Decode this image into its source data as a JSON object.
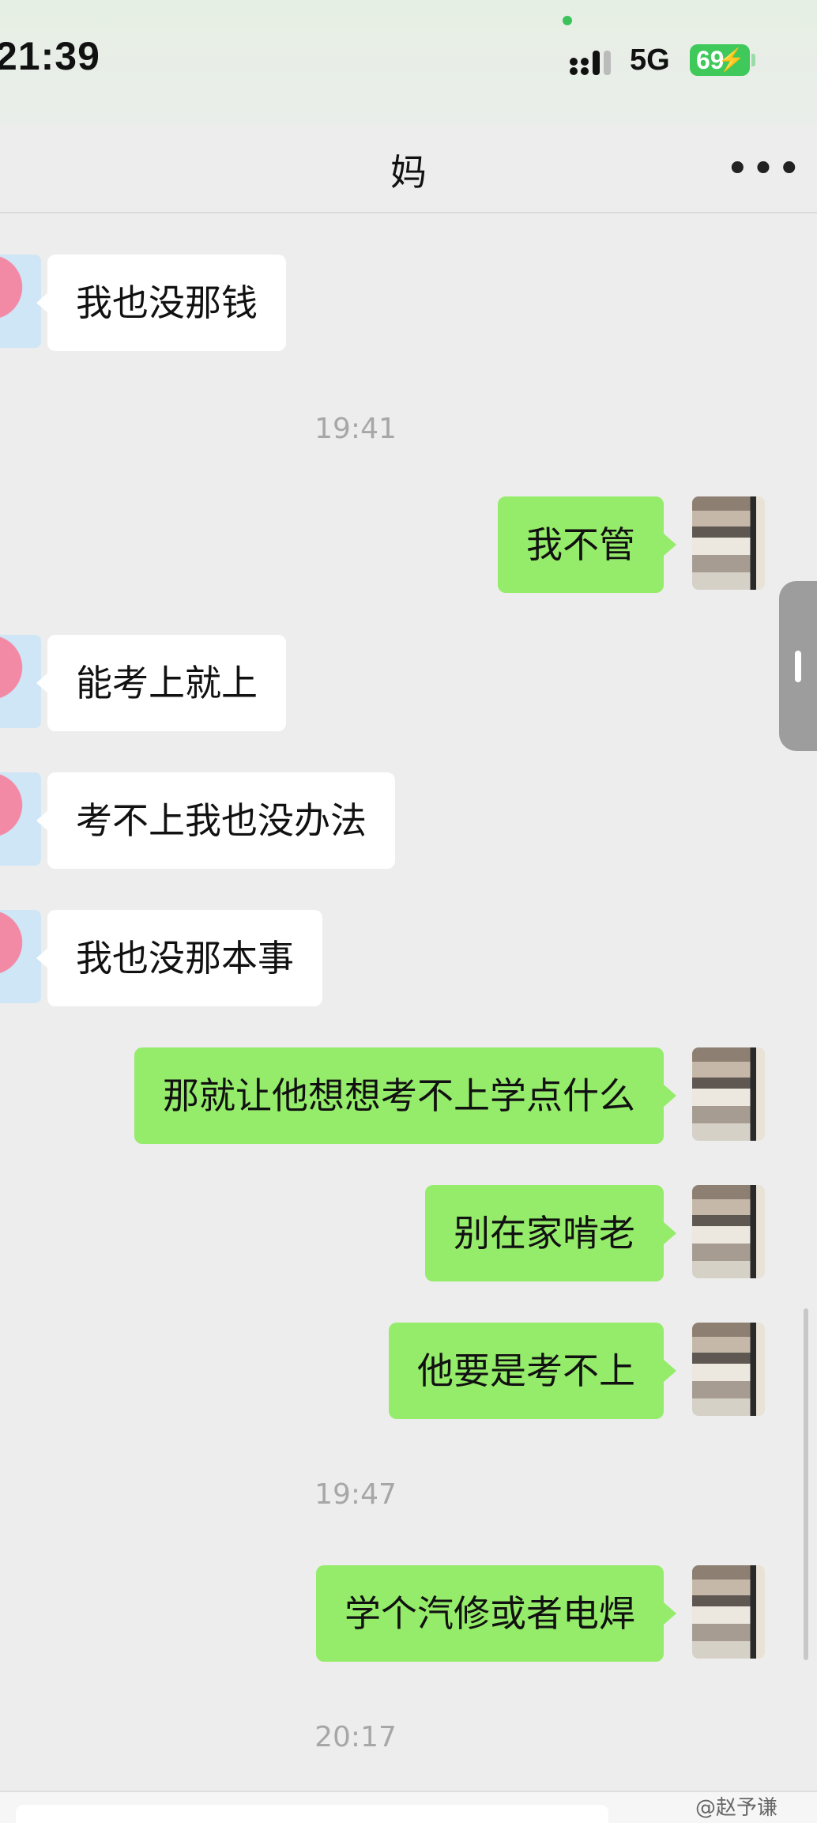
{
  "status_bar": {
    "time": "21:39",
    "network": "5G",
    "battery": "69"
  },
  "header": {
    "title": "妈",
    "more_icon": "more-dots-icon"
  },
  "messages": [
    {
      "side": "left",
      "text": "我也没那钱"
    },
    {
      "type": "timestamp",
      "text": "19:41"
    },
    {
      "side": "right",
      "text": "我不管"
    },
    {
      "side": "left",
      "text": "能考上就上"
    },
    {
      "side": "left",
      "text": "考不上我也没办法"
    },
    {
      "side": "left",
      "text": "我也没那本事"
    },
    {
      "side": "right",
      "text": "那就让他想想考不上学点什么"
    },
    {
      "side": "right",
      "text": "别在家啃老"
    },
    {
      "side": "right",
      "text": "他要是考不上"
    },
    {
      "type": "timestamp",
      "text": "19:47"
    },
    {
      "side": "right",
      "text": "学个汽修或者电焊"
    },
    {
      "type": "timestamp",
      "text": "20:17"
    }
  ],
  "watermark": "@赵予谦"
}
